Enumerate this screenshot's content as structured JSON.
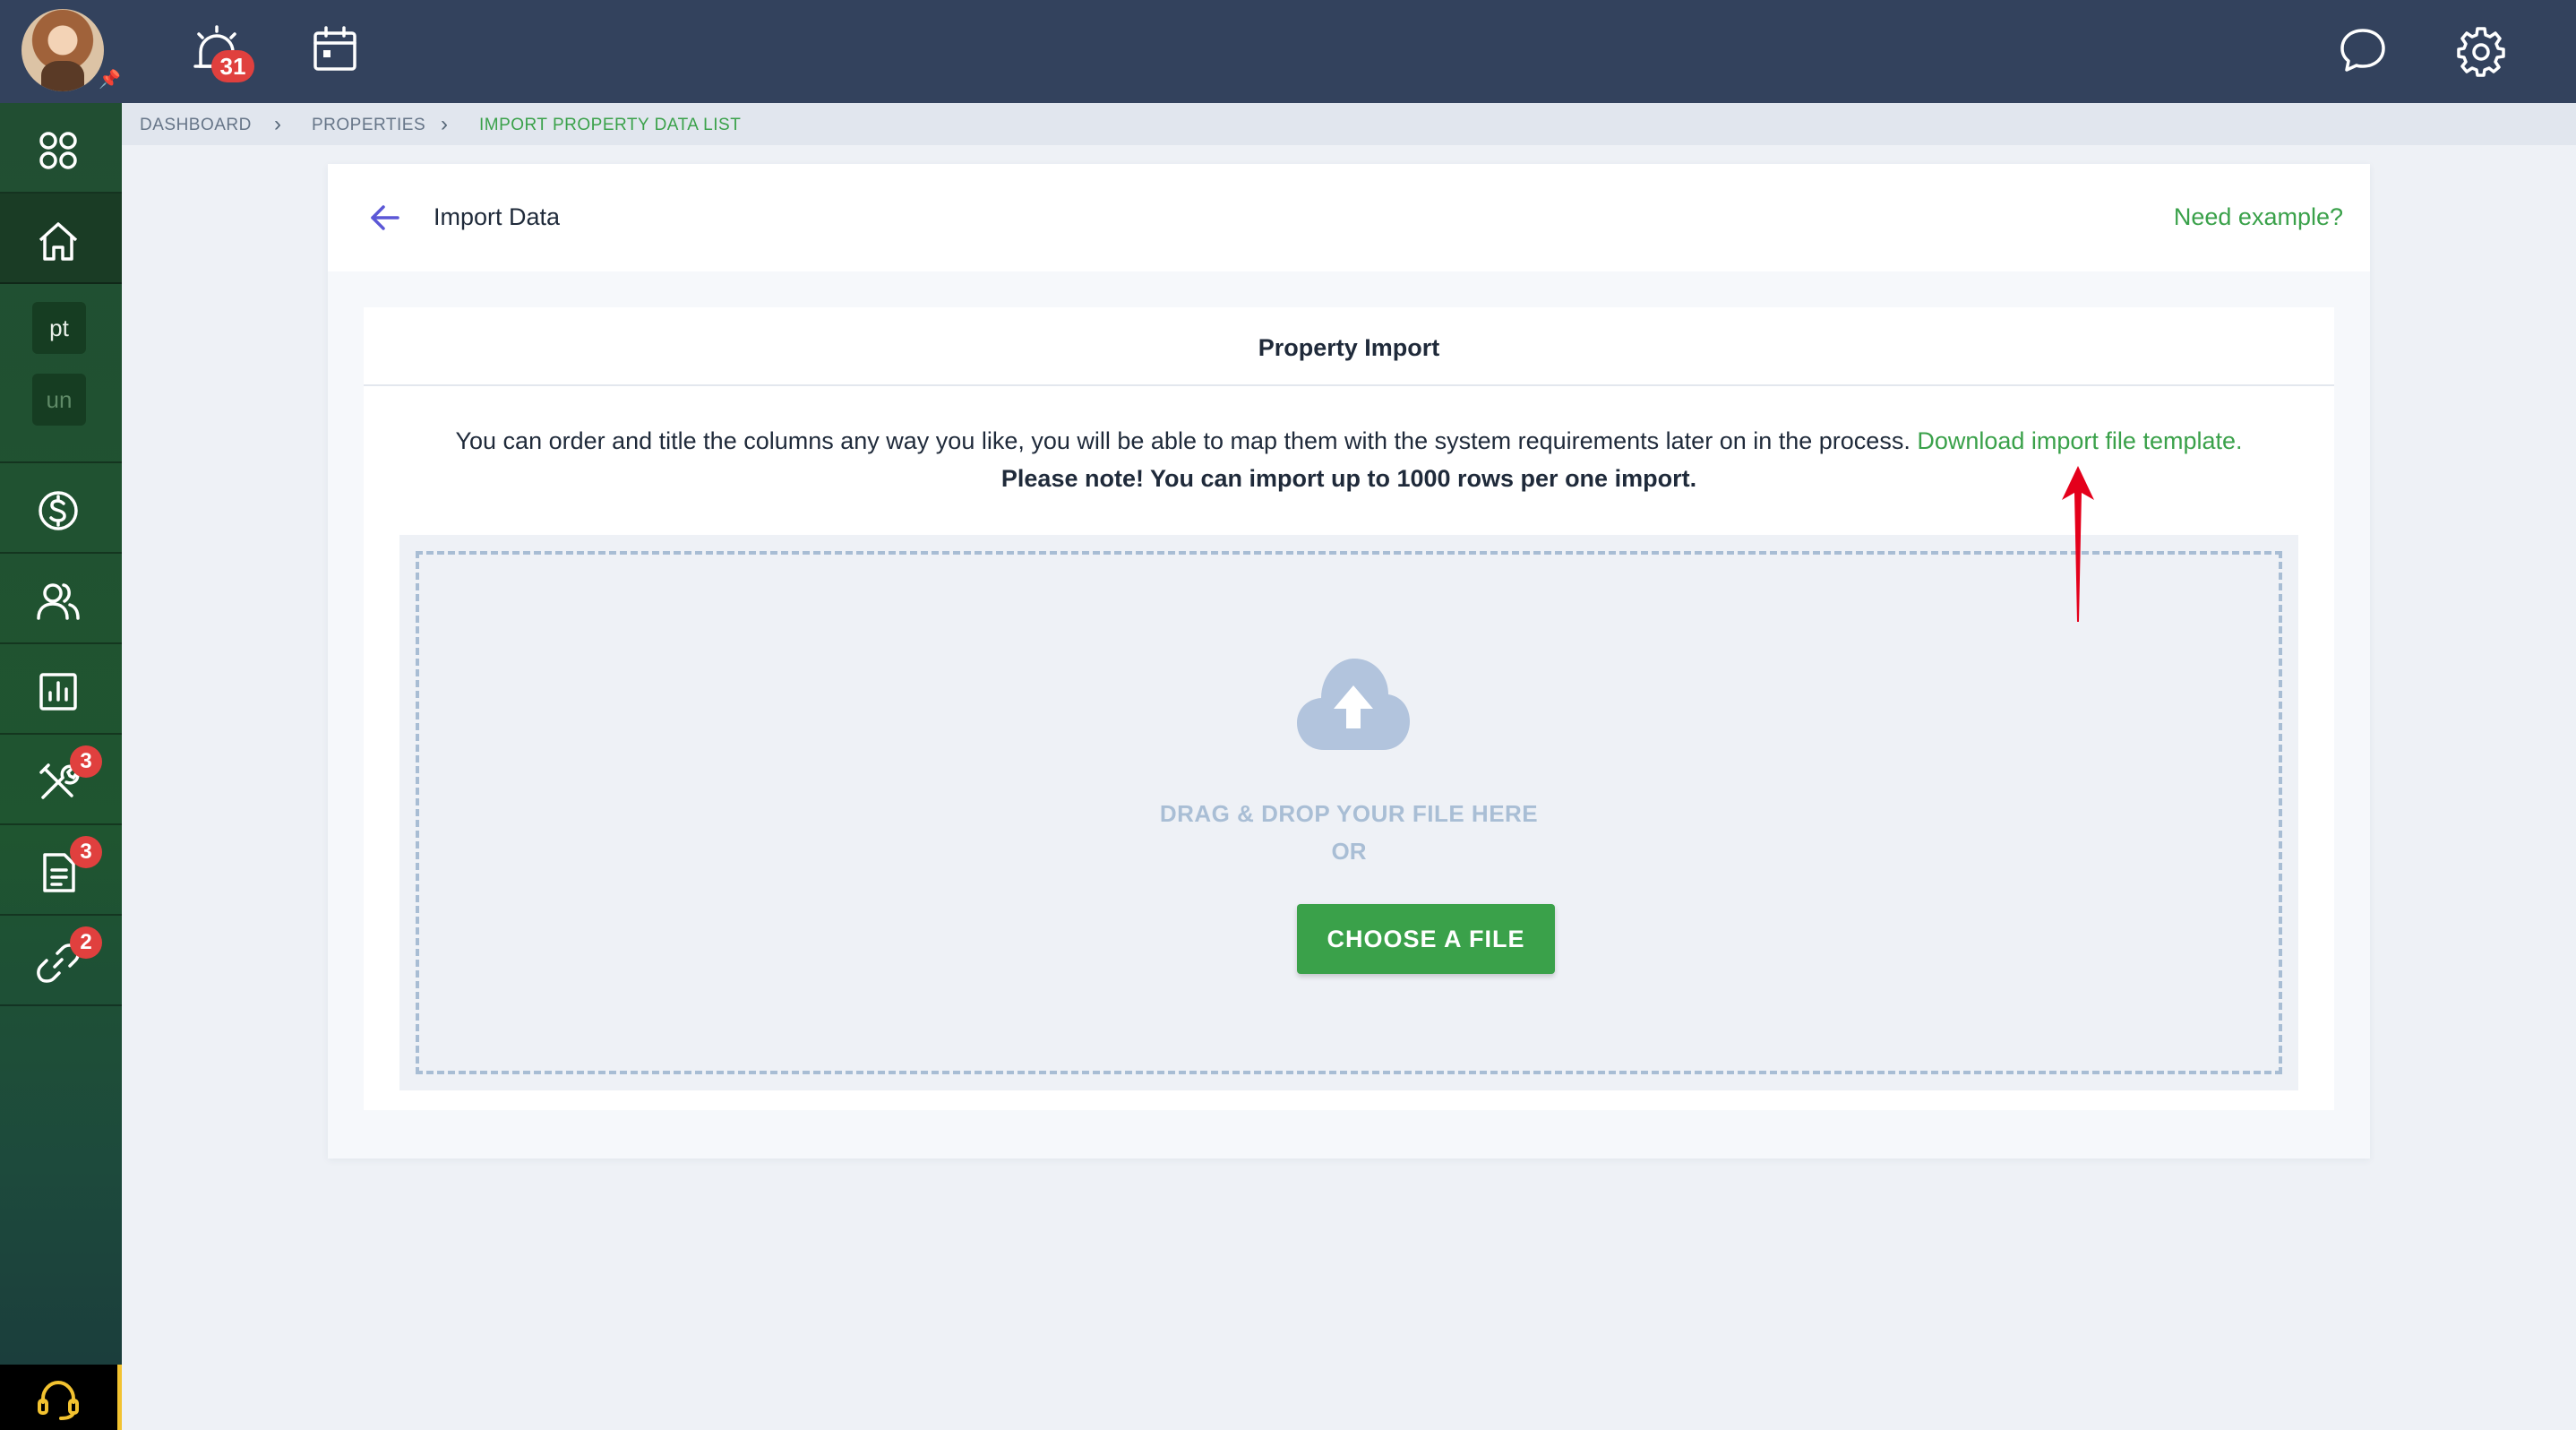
{
  "topbar": {
    "alerts_badge": "31",
    "icons": [
      "alarm-icon",
      "calendar-icon",
      "chat-icon",
      "gear-icon"
    ]
  },
  "sidebar": {
    "items": [
      {
        "icon": "apps-grid-icon"
      },
      {
        "icon": "home-icon",
        "active": true
      },
      {
        "chip": "pt"
      },
      {
        "chip": "un"
      },
      {
        "icon": "dollar-icon"
      },
      {
        "icon": "users-icon"
      },
      {
        "icon": "chart-icon"
      },
      {
        "icon": "tools-icon",
        "badge": "3"
      },
      {
        "icon": "document-icon",
        "badge": "3"
      },
      {
        "icon": "link-icon",
        "badge": "2"
      },
      {
        "icon": "headset-icon"
      }
    ]
  },
  "breadcrumb": {
    "items": [
      "DASHBOARD",
      "PROPERTIES",
      "IMPORT PROPERTY DATA LIST"
    ]
  },
  "header": {
    "title": "Import Data",
    "need_example": "Need example?"
  },
  "panel": {
    "title": "Property Import",
    "description": "You can order and title the columns any way you like, you will be able to map them with the system requirements later on in the process. ",
    "template_link": "Download import file template.",
    "note": "Please note! You can import up to 1000 rows per one import."
  },
  "dropzone": {
    "drag_text": "DRAG & DROP YOUR FILE HERE",
    "or_text": "OR",
    "button_label": "CHOOSE A FILE"
  },
  "colors": {
    "accent": "#3aa14a",
    "topbar": "#33425d",
    "badge": "#e0403e",
    "annotation_arrow": "#e4001b"
  }
}
